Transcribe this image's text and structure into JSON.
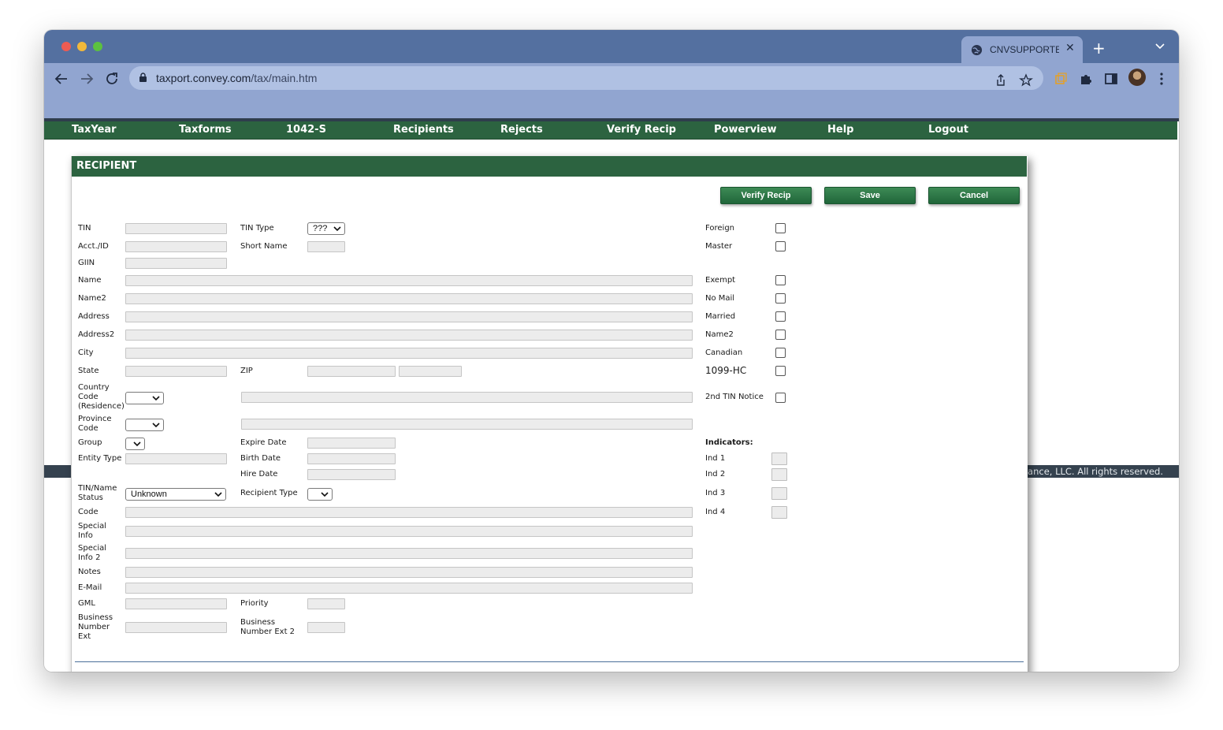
{
  "browser": {
    "tab_title": "CNVSUPPORTE",
    "url_host": "taxport.convey.com",
    "url_path": "/tax/main.htm",
    "icons": [
      "back-arrow-icon",
      "forward-arrow-icon",
      "reload-icon",
      "lock-icon",
      "share-icon",
      "star-icon",
      "extension-icon",
      "puzzle-icon",
      "sidepanel-icon",
      "kebab-menu-icon"
    ]
  },
  "menu": {
    "items": [
      "TaxYear",
      "Taxforms",
      "1042-S",
      "Recipients",
      "Rejects",
      "Verify Recip",
      "Powerview",
      "Help",
      "Logout"
    ]
  },
  "footer": {
    "text": "pliance, LLC. All rights reserved."
  },
  "modal": {
    "title": "RECIPIENT",
    "buttons": {
      "verify": "Verify Recip",
      "save": "Save",
      "cancel": "Cancel"
    },
    "labels": {
      "tin": "TIN",
      "tin_type": "TIN Type",
      "acct": "Acct./ID",
      "short_name": "Short Name",
      "giin": "GIIN",
      "name": "Name",
      "name2": "Name2",
      "address": "Address",
      "address2": "Address2",
      "city": "City",
      "state": "State",
      "zip": "ZIP",
      "country_1": "Country",
      "country_2": "Code",
      "country_3": "(Residence)",
      "province_1": "Province",
      "province_2": "Code",
      "group": "Group",
      "expire_date": "Expire Date",
      "entity_type": "Entity Type",
      "birth_date": "Birth Date",
      "hire_date": "Hire Date",
      "tin_status_1": "TIN/Name",
      "tin_status_2": "Status",
      "recipient_type": "Recipient Type",
      "code": "Code",
      "special_1": "Special",
      "special_2": "Info",
      "special2_1": "Special",
      "special2_2": "Info 2",
      "notes": "Notes",
      "email": "E-Mail",
      "gml": "GML",
      "priority": "Priority",
      "bne_1": "Business",
      "bne_2": "Number",
      "bne_3": "Ext",
      "bne2_1": "Business",
      "bne2_2": "Number Ext 2"
    },
    "selects": {
      "tin_type": "???",
      "tin_status": "Unknown"
    },
    "checks": {
      "foreign": "Foreign",
      "master": "Master",
      "exempt": "Exempt",
      "no_mail": "No Mail",
      "married": "Married",
      "name2": "Name2",
      "canadian": "Canadian",
      "hc1099": "1099-HC",
      "second_tin": "2nd TIN Notice"
    },
    "indicators": {
      "heading": "Indicators:",
      "ind1": "Ind 1",
      "ind2": "Ind 2",
      "ind3": "Ind 3",
      "ind4": "Ind 4"
    }
  }
}
